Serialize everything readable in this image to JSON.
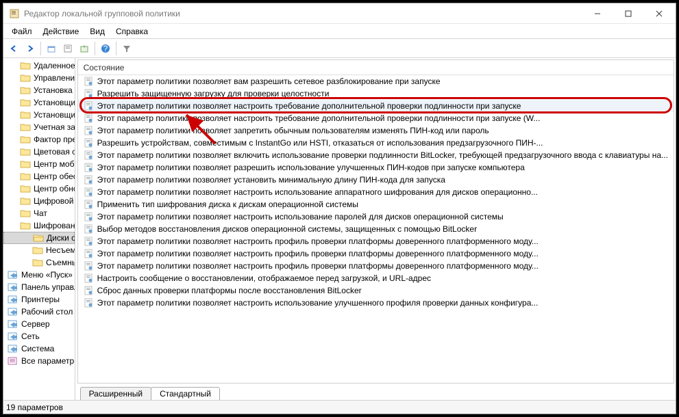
{
  "window": {
    "title": "Редактор локальной групповой политики"
  },
  "menu": {
    "file": "Файл",
    "action": "Действие",
    "view": "Вид",
    "help": "Справка"
  },
  "tree": {
    "items": [
      {
        "label": "Удаленное управление Windows",
        "indent": 1,
        "type": "folder"
      },
      {
        "label": "Управление цифровыми правами Windo",
        "indent": 1,
        "type": "folder"
      },
      {
        "label": "Установка нажатием",
        "indent": 1,
        "type": "folder"
      },
      {
        "label": "Установщик Windows",
        "indent": 1,
        "type": "folder"
      },
      {
        "label": "Установщик классических приложений",
        "indent": 1,
        "type": "folder"
      },
      {
        "label": "Учетная запись Майкрософт",
        "indent": 1,
        "type": "folder"
      },
      {
        "label": "Фактор предварительной проверки подл",
        "indent": 1,
        "type": "folder"
      },
      {
        "label": "Цветовая система Windows Color System",
        "indent": 1,
        "type": "folder"
      },
      {
        "label": "Центр мобильности Windows",
        "indent": 1,
        "type": "folder"
      },
      {
        "label": "Центр обеспечения безопасности",
        "indent": 1,
        "type": "folder"
      },
      {
        "label": "Центр обновления Windows",
        "indent": 1,
        "type": "folder"
      },
      {
        "label": "Цифровой ящик",
        "indent": 1,
        "type": "folder"
      },
      {
        "label": "Чат",
        "indent": 1,
        "type": "folder"
      },
      {
        "label": "Шифрование диска BitLocker",
        "indent": 1,
        "type": "folder"
      },
      {
        "label": "Диски операционной системы",
        "indent": 2,
        "type": "folder",
        "selected": true
      },
      {
        "label": "Несъемные диски с данными",
        "indent": 2,
        "type": "folder"
      },
      {
        "label": "Съемные носители с данными",
        "indent": 2,
        "type": "folder"
      },
      {
        "label": "Меню «Пуск» и панель задач",
        "indent": 0,
        "type": "link"
      },
      {
        "label": "Панель управления",
        "indent": 0,
        "type": "link"
      },
      {
        "label": "Принтеры",
        "indent": 0,
        "type": "link"
      },
      {
        "label": "Рабочий стол",
        "indent": 0,
        "type": "link"
      },
      {
        "label": "Сервер",
        "indent": 0,
        "type": "link"
      },
      {
        "label": "Сеть",
        "indent": 0,
        "type": "link"
      },
      {
        "label": "Система",
        "indent": 0,
        "type": "link"
      },
      {
        "label": "Все параметры",
        "indent": 0,
        "type": "extra"
      }
    ]
  },
  "list": {
    "header": "Состояние",
    "items": [
      "Этот параметр политики позволяет вам разрешить сетевое разблокирование при запуске",
      "Разрешить защищенную загрузку для проверки целостности",
      "Этот параметр политики позволяет настроить требование дополнительной проверки подлинности при запуске",
      "Этот параметр политики позволяет настроить требование дополнительной проверки подлинности при запуске (W...",
      "Этот параметр политики позволяет запретить обычным пользователям изменять ПИН-код или пароль",
      "Разрешить устройствам, совместимым с InstantGo или HSTI, отказаться от использования предзагрузочного ПИН-...",
      "Этот параметр политики позволяет включить использование проверки подлинности BitLocker, требующей предзагрузочного ввода с клавиатуры на...",
      "Этот параметр политики позволяет разрешить использование улучшенных ПИН-кодов при запуске компьютера",
      "Этот параметр политики позволяет установить минимальную длину ПИН-кода для запуска",
      "Этот параметр политики позволяет настроить использование аппаратного шифрования для дисков операционно...",
      "Применить тип шифрования диска к дискам операционной системы",
      "Этот параметр политики позволяет настроить использование паролей для дисков операционной системы",
      "Выбор методов восстановления дисков операционной системы, защищенных с помощью BitLocker",
      "Этот параметр политики позволяет настроить профиль проверки платформы доверенного платформенного моду...",
      "Этот параметр политики позволяет настроить профиль проверки платформы доверенного платформенного моду...",
      "Этот параметр политики позволяет настроить профиль проверки платформы доверенного платформенного моду...",
      "Настроить сообщение о восстановлении, отображаемое перед загрузкой, и URL-адрес",
      "Сброс данных проверки платформы после восстановления BitLocker",
      "Этот параметр политики позволяет настроить использование улучшенного профиля проверки данных конфигура..."
    ],
    "highlight_index": 2
  },
  "tabs": {
    "extended": "Расширенный",
    "standard": "Стандартный"
  },
  "status": {
    "text": "19 параметров"
  }
}
